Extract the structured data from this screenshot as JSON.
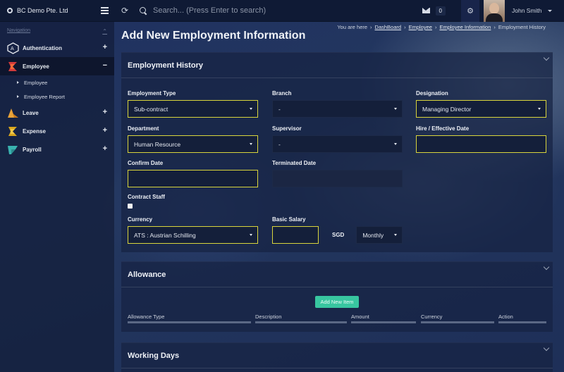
{
  "app": {
    "brand": "BC Demo Pte. Ltd"
  },
  "topbar": {
    "search_placeholder": "Search... (Press Enter to search)",
    "mail_count": "0",
    "user_name": "John Smith"
  },
  "sidebar": {
    "heading": "Navigation",
    "items": [
      {
        "label": "Authentication",
        "toggle": "+",
        "icon": "authentication-icon"
      },
      {
        "label": "Employee",
        "toggle": "−",
        "icon": "employee-icon"
      },
      {
        "label": "Leave",
        "toggle": "+",
        "icon": "leave-icon"
      },
      {
        "label": "Expense",
        "toggle": "+",
        "icon": "expense-icon"
      },
      {
        "label": "Payroll",
        "toggle": "+",
        "icon": "payroll-icon"
      }
    ],
    "sub_items": [
      "Employee",
      "Employee Report"
    ]
  },
  "page": {
    "title": "Add New Employment Information",
    "breadcrumb": {
      "prefix": "You are here",
      "links": [
        "DashBoard",
        "Employee",
        "Employee Information"
      ],
      "current": "Employment History"
    }
  },
  "employment_history": {
    "heading": "Employment History",
    "employment_type": {
      "label": "Employment Type",
      "value": "Sub-contract"
    },
    "branch": {
      "label": "Branch",
      "value": "-"
    },
    "designation": {
      "label": "Designation",
      "value": "Managing Director"
    },
    "department": {
      "label": "Department",
      "value": "Human Resource"
    },
    "supervisor": {
      "label": "Supervisor",
      "value": "-"
    },
    "hire_date": {
      "label": "Hire / Effective Date",
      "value": ""
    },
    "confirm_date": {
      "label": "Confirm Date",
      "value": ""
    },
    "terminated_date": {
      "label": "Terminated Date",
      "value": ""
    },
    "contract_staff": {
      "label": "Contract Staff",
      "checked": false
    },
    "currency": {
      "label": "Currency",
      "value": "ATS : Austrian Schilling"
    },
    "basic_salary": {
      "label": "Basic Salary",
      "value": "",
      "currency": "SGD",
      "period": "Monthly"
    }
  },
  "allowance": {
    "heading": "Allowance",
    "add_button": "Add New Item",
    "columns": [
      "Allowance Type",
      "Description",
      "Amount",
      "Currency",
      "Action"
    ]
  },
  "working_days": {
    "heading": "Working Days"
  },
  "colors": {
    "accent_yellow": "#d8d43c",
    "add_button": "#38c6a0",
    "topbar": "#0f1a35"
  }
}
